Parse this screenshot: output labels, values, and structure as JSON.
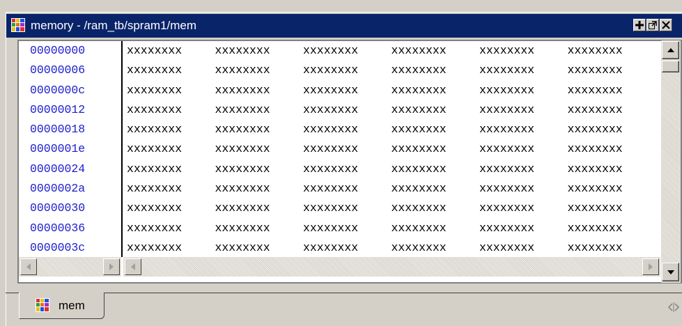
{
  "window": {
    "title": "memory - /ram_tb/spram1/mem",
    "title_icon": "memory-grid-icon",
    "buttons": [
      "maximize-plus-icon",
      "undock-icon",
      "close-icon"
    ]
  },
  "memory": {
    "addresses": [
      "00000000",
      "00000006",
      "0000000c",
      "00000012",
      "00000018",
      "0000001e",
      "00000024",
      "0000002a",
      "00000030",
      "00000036",
      "0000003c"
    ],
    "rows": [
      [
        "xxxxxxxx",
        "xxxxxxxx",
        "xxxxxxxx",
        "xxxxxxxx",
        "xxxxxxxx",
        "xxxxxxxx"
      ],
      [
        "xxxxxxxx",
        "xxxxxxxx",
        "xxxxxxxx",
        "xxxxxxxx",
        "xxxxxxxx",
        "xxxxxxxx"
      ],
      [
        "xxxxxxxx",
        "xxxxxxxx",
        "xxxxxxxx",
        "xxxxxxxx",
        "xxxxxxxx",
        "xxxxxxxx"
      ],
      [
        "xxxxxxxx",
        "xxxxxxxx",
        "xxxxxxxx",
        "xxxxxxxx",
        "xxxxxxxx",
        "xxxxxxxx"
      ],
      [
        "xxxxxxxx",
        "xxxxxxxx",
        "xxxxxxxx",
        "xxxxxxxx",
        "xxxxxxxx",
        "xxxxxxxx"
      ],
      [
        "xxxxxxxx",
        "xxxxxxxx",
        "xxxxxxxx",
        "xxxxxxxx",
        "xxxxxxxx",
        "xxxxxxxx"
      ],
      [
        "xxxxxxxx",
        "xxxxxxxx",
        "xxxxxxxx",
        "xxxxxxxx",
        "xxxxxxxx",
        "xxxxxxxx"
      ],
      [
        "xxxxxxxx",
        "xxxxxxxx",
        "xxxxxxxx",
        "xxxxxxxx",
        "xxxxxxxx",
        "xxxxxxxx"
      ],
      [
        "xxxxxxxx",
        "xxxxxxxx",
        "xxxxxxxx",
        "xxxxxxxx",
        "xxxxxxxx",
        "xxxxxxxx"
      ],
      [
        "xxxxxxxx",
        "xxxxxxxx",
        "xxxxxxxx",
        "xxxxxxxx",
        "xxxxxxxx",
        "xxxxxxxx"
      ],
      [
        "xxxxxxxx",
        "xxxxxxxx",
        "xxxxxxxx",
        "xxxxxxxx",
        "xxxxxxxx",
        "xxxxxxxx"
      ]
    ]
  },
  "tabs": [
    {
      "label": "mem",
      "icon": "memory-grid-icon",
      "active": true
    }
  ],
  "colors": {
    "titlebar": "#0a246a",
    "address_text": "#1c1ccc",
    "chrome": "#d4d0c8"
  }
}
